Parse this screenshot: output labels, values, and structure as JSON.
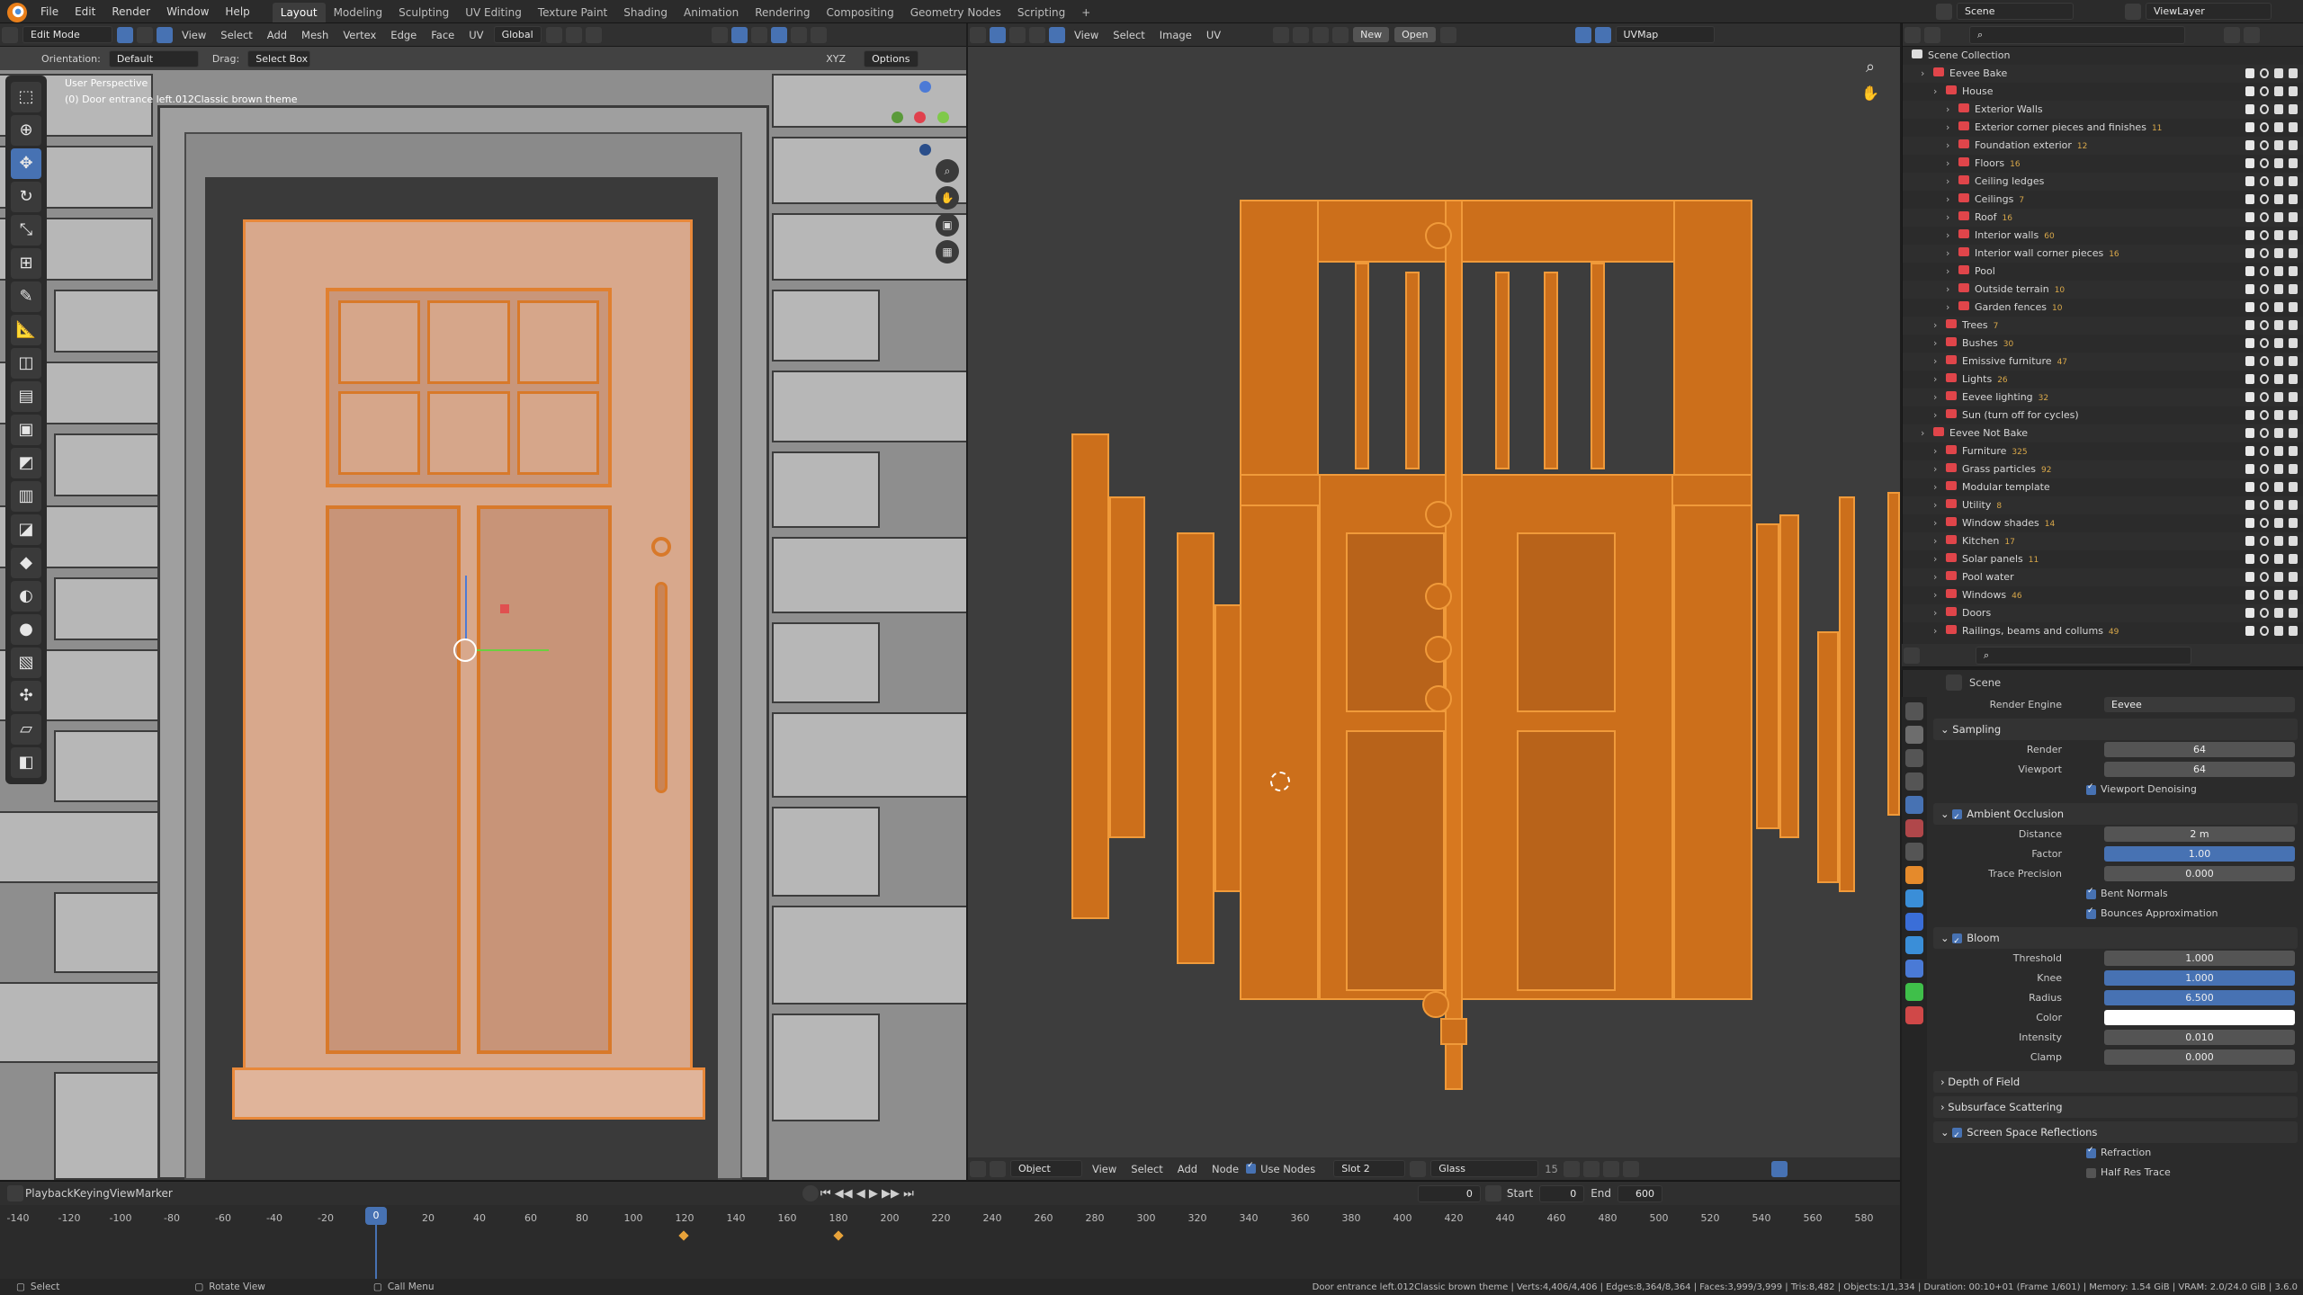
{
  "topbar": {
    "menus": [
      "File",
      "Edit",
      "Render",
      "Window",
      "Help"
    ],
    "workspaces": [
      "Layout",
      "Modeling",
      "Sculpting",
      "UV Editing",
      "Texture Paint",
      "Shading",
      "Animation",
      "Rendering",
      "Compositing",
      "Geometry Nodes",
      "Scripting"
    ],
    "active_workspace": "Layout",
    "scene": "Scene",
    "view_layer": "ViewLayer"
  },
  "viewport_header": {
    "mode": "Edit Mode",
    "menus": [
      "View",
      "Select",
      "Add",
      "Mesh",
      "Vertex",
      "Edge",
      "Face",
      "UV"
    ],
    "transform": "Global",
    "orientation_label": "Orientation:",
    "orientation": "Default",
    "drag_label": "Drag:",
    "drag": "Select Box",
    "axes": [
      "X",
      "Y",
      "Z"
    ],
    "options": "Options"
  },
  "viewport": {
    "perspective": "User Perspective",
    "object_info": "(0) Door entrance left.012Classic brown theme"
  },
  "uv_header": {
    "menus": [
      "View",
      "Select",
      "Image",
      "UV"
    ],
    "new": "New",
    "open": "Open",
    "uvmap": "UVMap"
  },
  "node_header": {
    "object": "Object",
    "menus": [
      "View",
      "Select",
      "Add",
      "Node"
    ],
    "use_nodes": "Use Nodes",
    "slot": "Slot 2",
    "material": "Glass",
    "users": "15"
  },
  "outliner": {
    "root": "Scene Collection",
    "rows": [
      {
        "name": "Eevee Bake",
        "indent": 1,
        "count": ""
      },
      {
        "name": "House",
        "indent": 2,
        "count": ""
      },
      {
        "name": "Exterior Walls",
        "indent": 3,
        "count": ""
      },
      {
        "name": "Exterior corner pieces and finishes",
        "indent": 3,
        "count": "11"
      },
      {
        "name": "Foundation exterior",
        "indent": 3,
        "count": "12"
      },
      {
        "name": "Floors",
        "indent": 3,
        "count": "16"
      },
      {
        "name": "Ceiling ledges",
        "indent": 3,
        "count": ""
      },
      {
        "name": "Ceilings",
        "indent": 3,
        "count": "7"
      },
      {
        "name": "Roof",
        "indent": 3,
        "count": "16"
      },
      {
        "name": "Interior walls",
        "indent": 3,
        "count": "60"
      },
      {
        "name": "Interior wall corner pieces",
        "indent": 3,
        "count": "16"
      },
      {
        "name": "Pool",
        "indent": 3,
        "count": ""
      },
      {
        "name": "Outside terrain",
        "indent": 3,
        "count": "10"
      },
      {
        "name": "Garden fences",
        "indent": 3,
        "count": "10"
      },
      {
        "name": "Trees",
        "indent": 2,
        "count": "7"
      },
      {
        "name": "Bushes",
        "indent": 2,
        "count": "30"
      },
      {
        "name": "Emissive furniture",
        "indent": 2,
        "count": "47"
      },
      {
        "name": "Lights",
        "indent": 2,
        "count": "26"
      },
      {
        "name": "Eevee lighting",
        "indent": 2,
        "count": "32"
      },
      {
        "name": "Sun (turn off for cycles)",
        "indent": 2,
        "count": ""
      },
      {
        "name": "Eevee Not Bake",
        "indent": 1,
        "count": ""
      },
      {
        "name": "Furniture",
        "indent": 2,
        "count": "325"
      },
      {
        "name": "Grass particles",
        "indent": 2,
        "count": "92"
      },
      {
        "name": "Modular template",
        "indent": 2,
        "count": ""
      },
      {
        "name": "Utility",
        "indent": 2,
        "count": "8"
      },
      {
        "name": "Window shades",
        "indent": 2,
        "count": "14"
      },
      {
        "name": "Kitchen",
        "indent": 2,
        "count": "17"
      },
      {
        "name": "Solar panels",
        "indent": 2,
        "count": "11"
      },
      {
        "name": "Pool water",
        "indent": 2,
        "count": ""
      },
      {
        "name": "Windows",
        "indent": 2,
        "count": "46"
      },
      {
        "name": "Doors",
        "indent": 2,
        "count": ""
      },
      {
        "name": "Railings, beams and collums",
        "indent": 2,
        "count": "49"
      }
    ]
  },
  "properties": {
    "context": "Scene",
    "render_engine_label": "Render Engine",
    "render_engine": "Eevee",
    "sampling": {
      "title": "Sampling",
      "render_label": "Render",
      "render": "64",
      "viewport_label": "Viewport",
      "viewport": "64",
      "denoise": "Viewport Denoising"
    },
    "ao": {
      "title": "Ambient Occlusion",
      "distance_label": "Distance",
      "distance": "2 m",
      "factor_label": "Factor",
      "factor": "1.00",
      "precision_label": "Trace Precision",
      "precision": "0.000",
      "bent": "Bent Normals",
      "bounces": "Bounces Approximation"
    },
    "bloom": {
      "title": "Bloom",
      "threshold_label": "Threshold",
      "threshold": "1.000",
      "knee_label": "Knee",
      "knee": "1.000",
      "radius_label": "Radius",
      "radius": "6.500",
      "color_label": "Color",
      "intensity_label": "Intensity",
      "intensity": "0.010",
      "clamp_label": "Clamp",
      "clamp": "0.000"
    },
    "dof": "Depth of Field",
    "sss": "Subsurface Scattering",
    "ssr": {
      "title": "Screen Space Reflections",
      "refraction": "Refraction",
      "half_res": "Half Res Trace"
    }
  },
  "timeline": {
    "menus": [
      "Playback",
      "Keying",
      "View",
      "Marker"
    ],
    "current_frame": "0",
    "start_label": "Start",
    "start": "0",
    "end_label": "End",
    "end": "600",
    "ticks": [
      "-140",
      "-120",
      "-100",
      "-80",
      "-60",
      "-40",
      "-20",
      "0",
      "20",
      "40",
      "60",
      "80",
      "100",
      "120",
      "140",
      "160",
      "180",
      "200",
      "220",
      "240",
      "260",
      "280",
      "300",
      "320",
      "340",
      "360",
      "380",
      "400",
      "420",
      "440",
      "460",
      "480",
      "500",
      "520",
      "540",
      "560",
      "580"
    ]
  },
  "statusbar": {
    "select": "Select",
    "rotate": "Rotate View",
    "call_menu": "Call Menu",
    "stats": "Door entrance left.012Classic brown theme | Verts:4,406/4,406 | Edges:8,364/8,364 | Faces:3,999/3,999 | Tris:8,482 | Objects:1/1,334 | Duration: 00:10+01 (Frame 1/601) | Memory: 1.54 GiB | VRAM: 2.0/24.0 GiB | 3.6.0"
  }
}
